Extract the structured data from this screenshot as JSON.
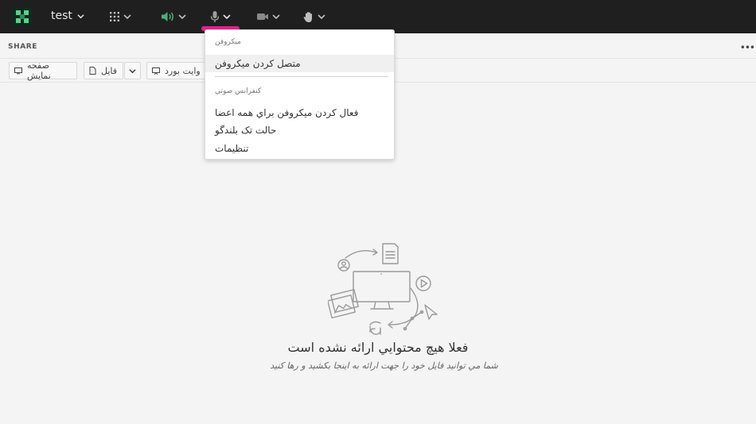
{
  "toolbar": {
    "room_title": "test",
    "accent_active": "#4caf7a",
    "accent_mic": "#e91e8c"
  },
  "panel": {
    "title": "SHARE"
  },
  "share_buttons": {
    "screen": "صفحه نمایش",
    "file": "فایل",
    "whiteboard": "وایت بورد"
  },
  "microphone_menu": {
    "section_microphone": "میکروفن",
    "connect_microphone": "متصل کردن میکروفن",
    "section_conference": "کنفرانس صوتي",
    "enable_all_mics": "فعال کردن میکروفن براي همه اعضا",
    "speaker_mode": "حالت تک بلندگو",
    "settings": "تنظیمات"
  },
  "empty_state": {
    "title": "فعلا هیچ محتوایي ارائه نشده است",
    "subtitle": "شما مي توانید فایل خود را جهت ارائه به اینجا بکشید و رها کنید"
  },
  "icons": [
    "app-logo-icon",
    "apps-grid-icon",
    "speaker-icon",
    "microphone-icon",
    "camera-icon",
    "raise-hand-icon",
    "chevron-down-icon",
    "monitor-icon",
    "file-icon",
    "whiteboard-icon"
  ]
}
